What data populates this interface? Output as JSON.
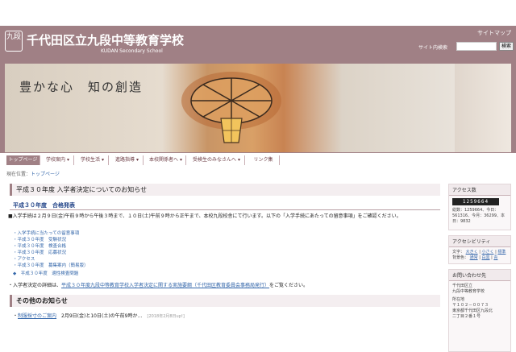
{
  "header": {
    "logo_text": "九段",
    "title": "千代田区立九段中等教育学校",
    "subtitle": "KUDAN Secondary School",
    "sitemap": "サイトマップ",
    "search_label": "サイト内検索",
    "search_placeholder": "",
    "search_button": "検索"
  },
  "hero": {
    "slogan": "豊かな心　知の創造"
  },
  "nav": {
    "items": [
      {
        "label": "トップページ"
      },
      {
        "label": "学校案内 ▾"
      },
      {
        "label": "学校生活 ▾"
      },
      {
        "label": "進路指導 ▾"
      },
      {
        "label": "本校関係者へ ▾"
      },
      {
        "label": "受検生のみなさんへ ▾"
      },
      {
        "label": "リンク集"
      }
    ]
  },
  "breadcrumb": {
    "prefix": "現在位置：",
    "current": "トップページ"
  },
  "main": {
    "title": "平成３０年度 入学者決定についてのお知らせ",
    "section_title": "平成３０年度　合格発表",
    "notice": "■入学手続は２月９日(金)午前９時から午後３時まで、１０日(土)午前９時から正午まで、本校九段校舎にて行います。以下の「入学手続にあたっての留意事項」をご確認ください。",
    "links": [
      "入学手続に当たっての留意事項",
      "平成３０年度　受験状況",
      "平成３０年度　検査合格",
      "平成３０年度　応募状況",
      "アクセス",
      "平成３０年度　募集案内（簡易版）"
    ],
    "aptitude_link": "平成３０年度　適性検査問題",
    "detail_prefix": "・入学者決定の詳細は、",
    "detail_link": "平成３０年度九段中等教育学校入学者決定に関する実施要綱（千代田区教育委員会事務局発行）",
    "detail_suffix": "をご覧ください。"
  },
  "other": {
    "title": "その他のお知らせ",
    "news": [
      {
        "link": "制服採寸のご案内",
        "text": "2月9日(金)と10日(土)の午前9時か…",
        "date": "[2018年2月8日up!]"
      }
    ]
  },
  "sidebar": {
    "access_title": "アクセス数",
    "counter": "1259664",
    "access_text": "総数：1259664、今日：561316、今月：36299、本日：9832",
    "a11y_title": "アクセシビリティ",
    "a11y_size_label": "文字：",
    "a11y_size": [
      "大きく",
      "小さく",
      "標準"
    ],
    "a11y_color_label": "背景色：",
    "a11y_color": [
      "通常",
      "白黒",
      "青"
    ],
    "contact_title": "お問い合わせ先",
    "contact_name": "千代田区立",
    "contact_school": "九段中等教育学校",
    "contact_addr_label": "所在地",
    "contact_postal": "〒１０２－００７３",
    "contact_addr1": "東京都千代田区九段北",
    "contact_addr2": "二丁目２番１号"
  }
}
